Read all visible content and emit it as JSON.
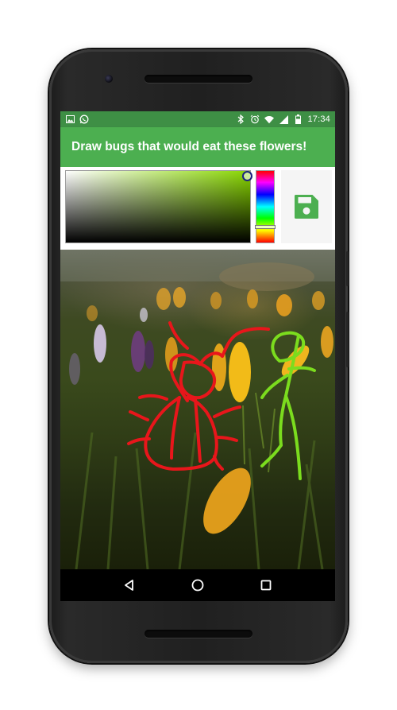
{
  "status_bar": {
    "left_icons": [
      "image-icon",
      "whatsapp-icon"
    ],
    "right_icons": [
      "bluetooth-icon",
      "alarm-icon",
      "wifi-icon",
      "signal-icon",
      "battery-icon"
    ],
    "time": "17:34"
  },
  "app_bar": {
    "title": "Draw bugs that would eat these flowers!"
  },
  "color_picker": {
    "selected_hue_color": "#88d600",
    "save_icon": "floppy-disk-icon"
  },
  "canvas": {
    "background": "photo-of-crocus-flowers-in-grass",
    "stroke_colors": [
      "#e8161b",
      "#7bdc1e"
    ]
  },
  "navigation": {
    "buttons": [
      "back-icon",
      "home-icon",
      "recents-icon"
    ]
  },
  "colors": {
    "status_bar": "#3e8f45",
    "app_bar": "#4caf50",
    "accent": "#4caf50"
  }
}
